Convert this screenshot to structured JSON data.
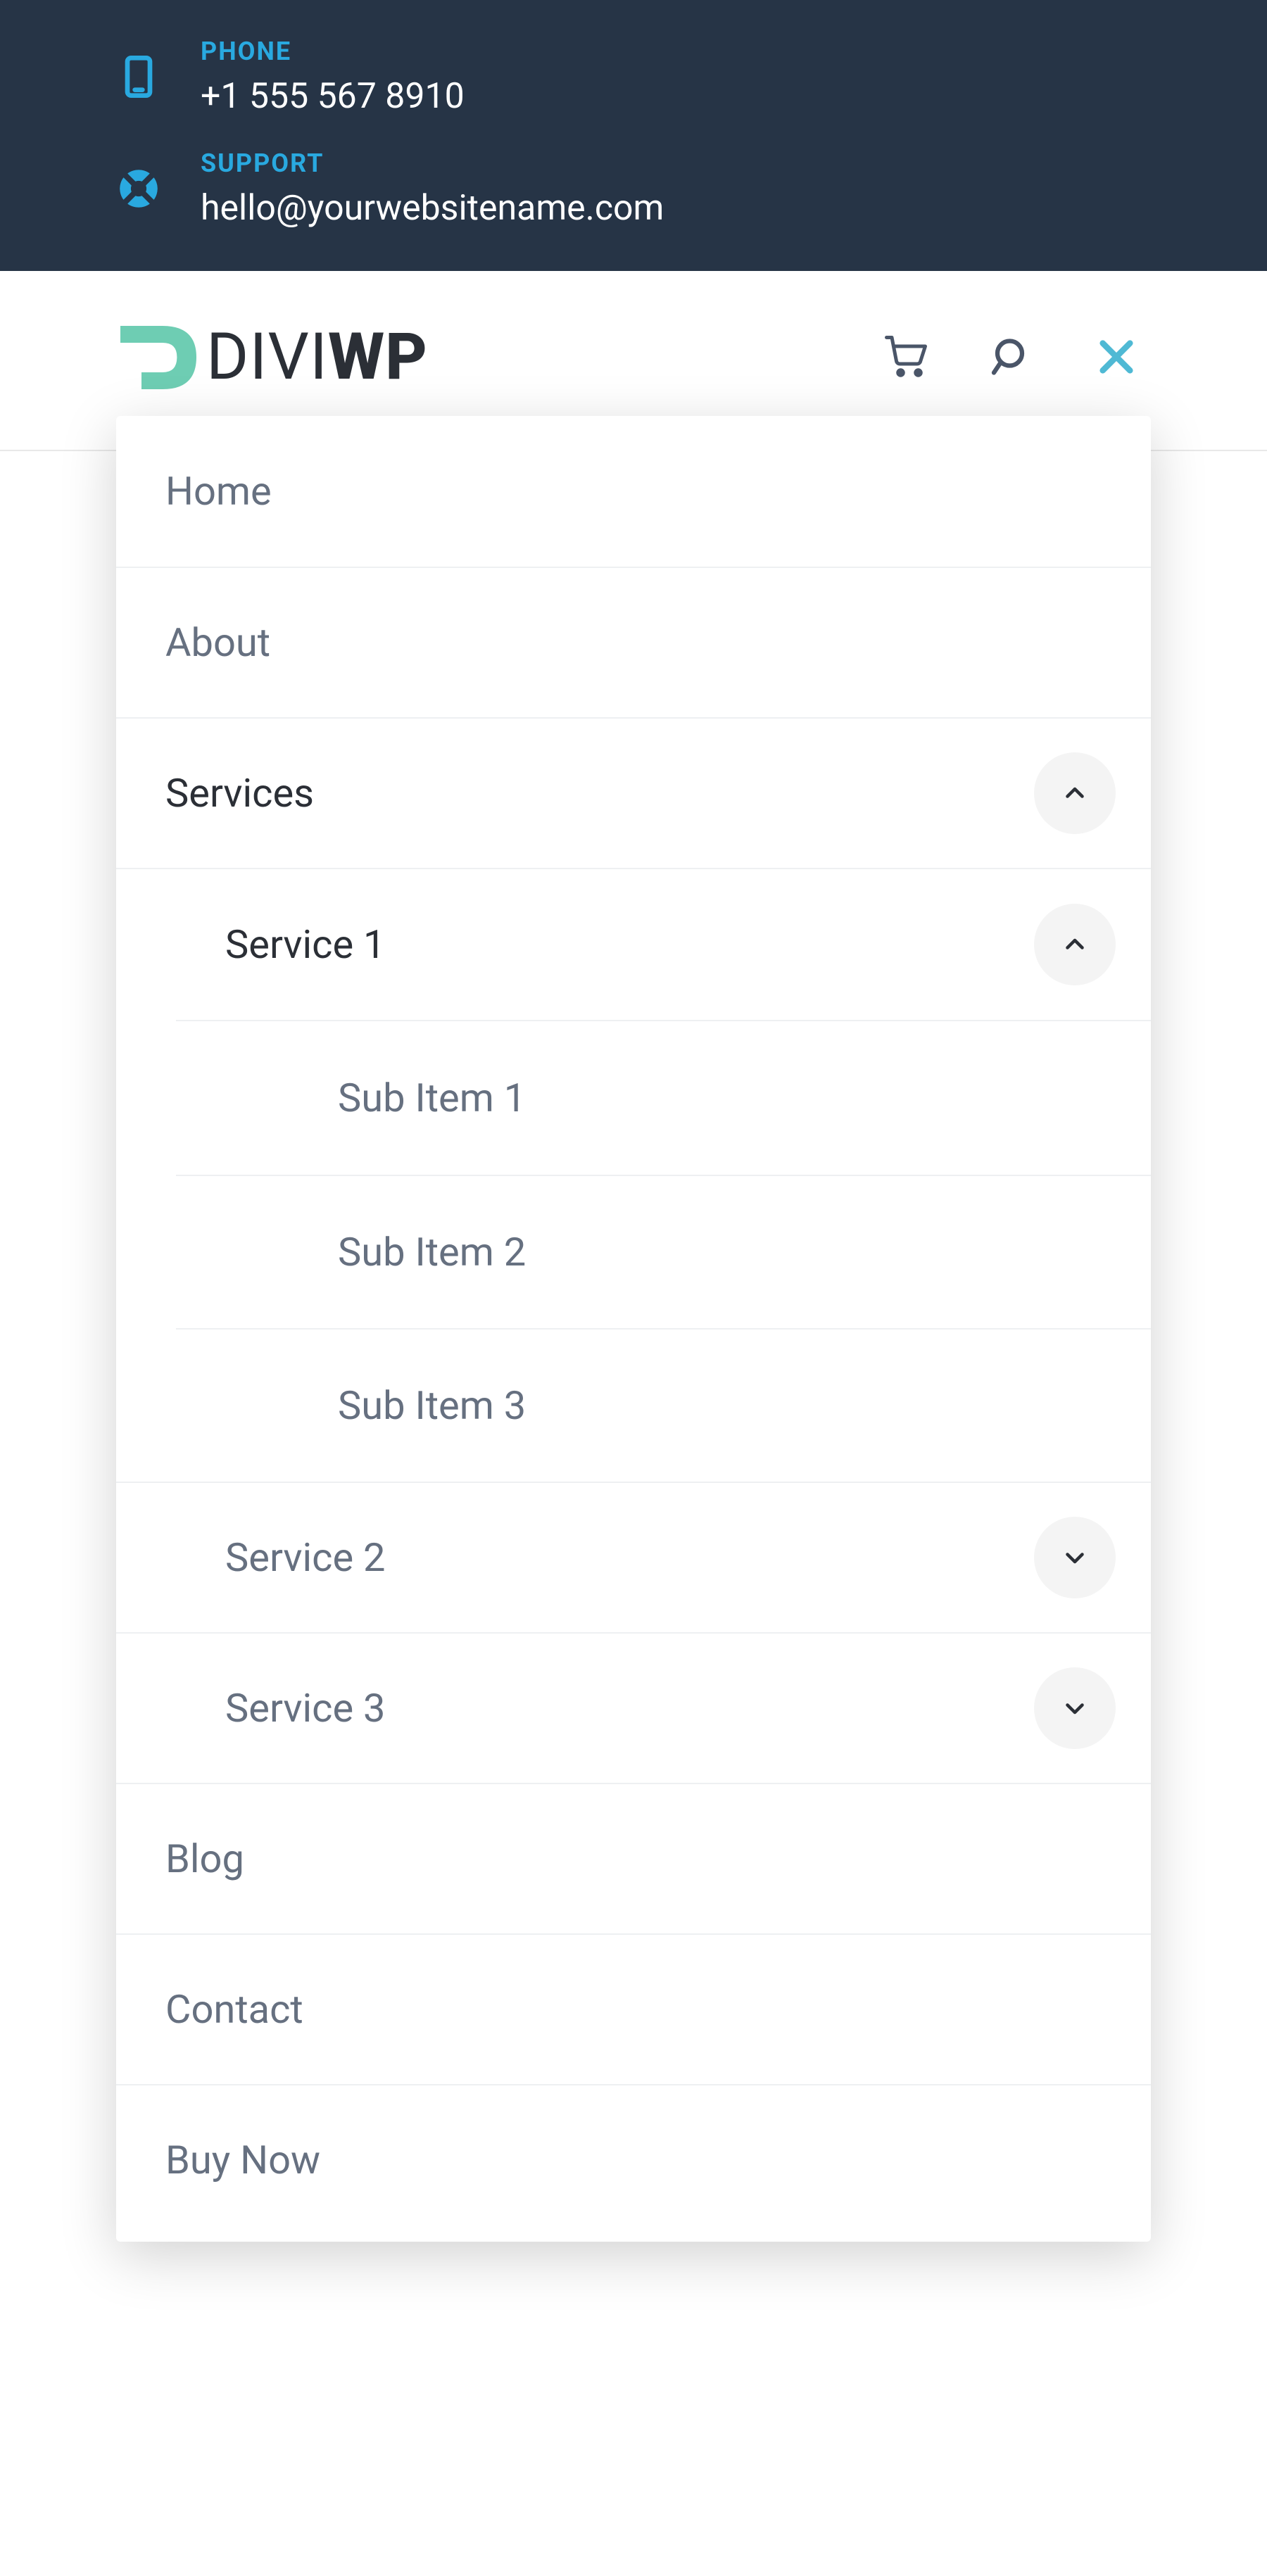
{
  "topbar": {
    "phone": {
      "label": "PHONE",
      "value": "+1 555 567 8910"
    },
    "support": {
      "label": "SUPPORT",
      "value": "hello@yourwebsitename.com"
    }
  },
  "logo": {
    "part1": "DIVI",
    "part2": "WP"
  },
  "menu": {
    "home": "Home",
    "about": "About",
    "services": {
      "label": "Services",
      "children": {
        "service1": {
          "label": "Service 1",
          "children": {
            "sub1": "Sub Item 1",
            "sub2": "Sub Item 2",
            "sub3": "Sub Item 3"
          }
        },
        "service2": {
          "label": "Service 2"
        },
        "service3": {
          "label": "Service 3"
        }
      }
    },
    "blog": "Blog",
    "contact": "Contact",
    "buynow": "Buy Now"
  }
}
